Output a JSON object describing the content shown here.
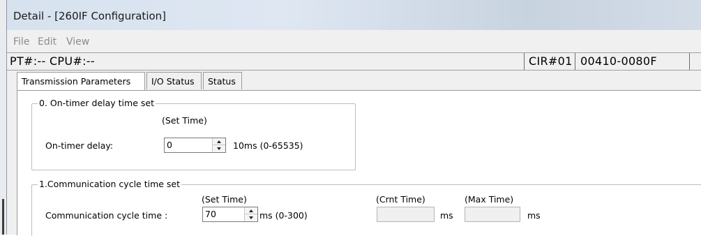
{
  "window": {
    "title": "Detail - [260IF Configuration]"
  },
  "menu": {
    "items": [
      "File",
      "Edit",
      "View"
    ]
  },
  "status": {
    "pt_cpu": "PT#:-- CPU#:--",
    "cir": "CIR#01",
    "model": "00410-0080F",
    "extra": ""
  },
  "tabs": [
    {
      "label": "Transmission Parameters",
      "active": true
    },
    {
      "label": "I/O Status",
      "active": false
    },
    {
      "label": "Status",
      "active": false
    }
  ],
  "section0": {
    "legend": "0. On-timer delay time set",
    "set_time_header": "(Set Time)",
    "field_label": "On-timer delay:",
    "value": "0",
    "unit": "10ms (0-65535)"
  },
  "section1": {
    "legend": "1.Communication cycle time set",
    "set_time_header": "(Set Time)",
    "crnt_time_header": "(Crnt Time)",
    "max_time_header": "(Max Time)",
    "field_label": "Communication cycle time :",
    "value": "70",
    "unit": "ms (0-300)",
    "crnt_value": "",
    "crnt_unit": "ms",
    "max_value": "",
    "max_unit": "ms"
  },
  "colors": {
    "window_bg": "#f0f0f0",
    "panel_bg": "#ffffff",
    "menu_text_disabled": "#8b8b8b"
  }
}
